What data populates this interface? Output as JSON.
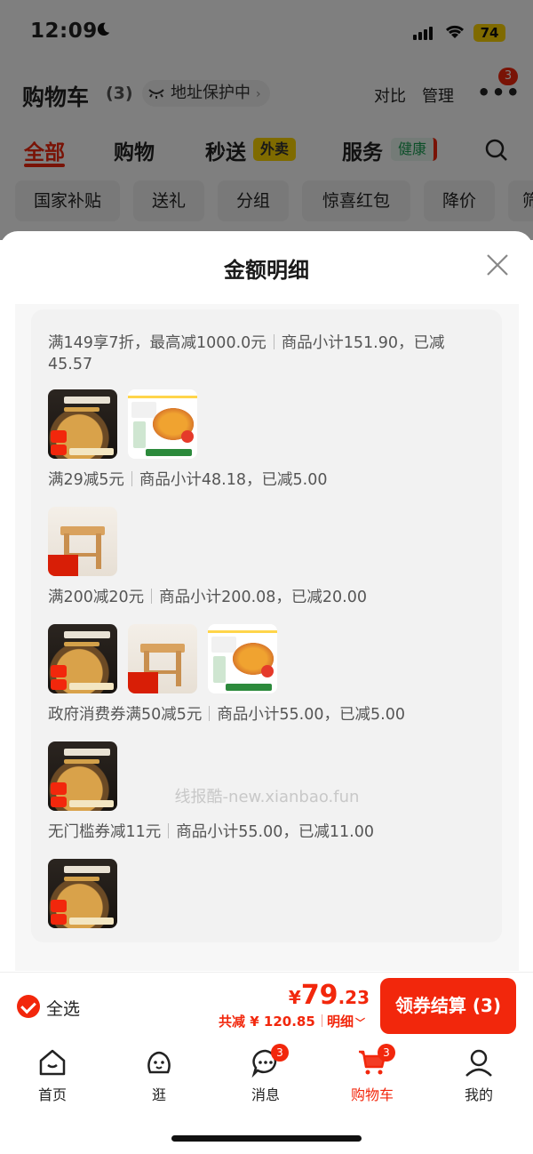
{
  "status_bar": {
    "time": "12:09",
    "battery": "74"
  },
  "header": {
    "title": "购物车",
    "count": "(3)",
    "address": "地址保护中",
    "compare": "对比",
    "manage": "管理",
    "more": "•••",
    "more_badge": "3"
  },
  "tabs": [
    {
      "label": "全部",
      "active": true
    },
    {
      "label": "购物"
    },
    {
      "label": "秒送",
      "tag": "外卖"
    },
    {
      "label": "服务",
      "tag": "健康"
    }
  ],
  "chips": [
    "国家补贴",
    "送礼",
    "分组",
    "惊喜红包",
    "降价",
    "筛"
  ],
  "sheet": {
    "title": "金额明细",
    "rules": [
      {
        "a": "满149享7折，最高减1000.0元",
        "b": "商品小计151.90，已减45.57"
      },
      {
        "a": "满29减5元",
        "b": "商品小计48.18，已减5.00"
      },
      {
        "a": "满200减20元",
        "b": "商品小计200.08，已减20.00"
      },
      {
        "a": "政府消费券满50减5元",
        "b": "商品小计55.00，已减5.00"
      },
      {
        "a": "无门槛券减11元",
        "b": "商品小计55.00，已减11.00"
      }
    ],
    "watermark": "线报酷-new.xianbao.fun"
  },
  "cart_bar": {
    "select_all": "全选",
    "currency": "¥",
    "total_int": "79",
    "total_dec": ".23",
    "saved": "共减 ¥ 120.85",
    "detail": "明细",
    "checkout": "领券结算 (3)"
  },
  "tabbar": [
    {
      "label": "首页",
      "icon": "home-icon"
    },
    {
      "label": "逛",
      "icon": "browse-icon"
    },
    {
      "label": "消息",
      "icon": "message-icon",
      "badge": "3"
    },
    {
      "label": "购物车",
      "icon": "cart-icon",
      "badge": "3",
      "active": true
    },
    {
      "label": "我的",
      "icon": "profile-icon"
    }
  ],
  "colors": {
    "accent": "#f2270c",
    "takeout_tag": "#ffd600",
    "health_tag": "#1a9f53"
  }
}
